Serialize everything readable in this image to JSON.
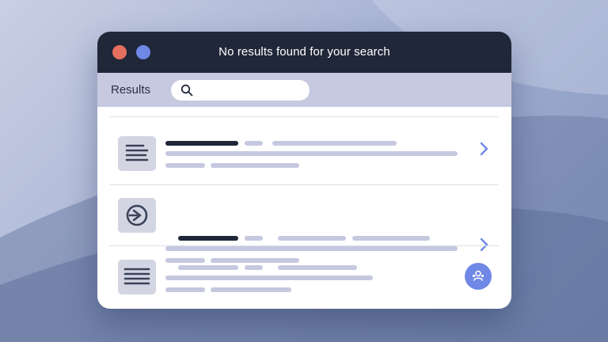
{
  "window": {
    "title": "No results found for your search"
  },
  "toolbar": {
    "label": "Results",
    "search": {
      "value": "",
      "placeholder": ""
    }
  },
  "icons": {
    "close": "red-dot",
    "minimize": "blue-dot",
    "search": "search-icon",
    "list": "document-lines-icon",
    "play": "play-circle-icon",
    "chevron": "chevron-right-icon",
    "users": "users-icon"
  },
  "colors": {
    "titlebar": "#1f2739",
    "toolbar": "#c6c9e0",
    "accent": "#6f88e6",
    "close_dot": "#e56f5f",
    "placeholder_bar": "#c6c8e0"
  },
  "results": [
    {
      "thumb": "document-lines-icon",
      "action": "chevron"
    },
    {
      "thumb": "play-circle-icon",
      "action": "chevron"
    },
    {
      "thumb": "document-lines-icon",
      "action": "avatar"
    }
  ]
}
